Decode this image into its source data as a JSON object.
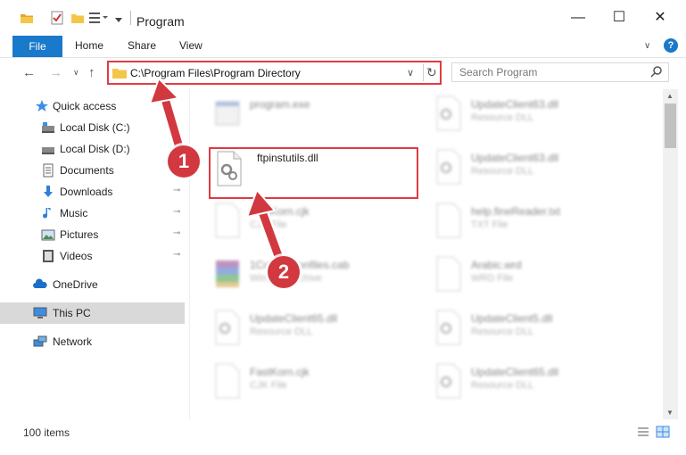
{
  "window": {
    "title": "Program",
    "controls": {
      "minimize": "—",
      "maximize": "☐",
      "close": "✕"
    }
  },
  "ribbon": {
    "tabs": [
      "File",
      "Home",
      "Share",
      "View"
    ],
    "expand_glyph": "∨",
    "help_glyph": "?"
  },
  "nav": {
    "back_glyph": "←",
    "forward_glyph": "→",
    "recent_glyph": "∨",
    "up_glyph": "↑",
    "address": "C:\\Program Files\\Program Directory",
    "address_dropdown_glyph": "∨",
    "refresh_glyph": "↻",
    "search_placeholder": "Search Program"
  },
  "sidebar": {
    "items": [
      {
        "label": "Quick access",
        "icon": "star-icon",
        "pinned": false
      },
      {
        "label": "Local Disk (C:)",
        "icon": "drive-icon",
        "pinned": false
      },
      {
        "label": "Local Disk (D:)",
        "icon": "drive-icon",
        "pinned": false
      },
      {
        "label": "Documents",
        "icon": "documents-icon",
        "pinned": false
      },
      {
        "label": "Downloads",
        "icon": "download-icon",
        "pinned": true
      },
      {
        "label": "Music",
        "icon": "music-icon",
        "pinned": true
      },
      {
        "label": "Pictures",
        "icon": "pictures-icon",
        "pinned": true
      },
      {
        "label": "Videos",
        "icon": "videos-icon",
        "pinned": true
      },
      {
        "label": "OneDrive",
        "icon": "cloud-icon",
        "pinned": false
      },
      {
        "label": "This PC",
        "icon": "computer-icon",
        "pinned": false,
        "selected": true
      },
      {
        "label": "Network",
        "icon": "network-icon",
        "pinned": false
      }
    ],
    "pin_glyph": "📌"
  },
  "files": {
    "left": [
      {
        "name": "program.exe",
        "type": "",
        "icon": "exe-icon"
      },
      {
        "name": "ftpinstutils.dll",
        "type": "",
        "icon": "dll-gear-icon",
        "highlighted": true
      },
      {
        "name": "FastKorn.cjk",
        "type": "CJK File",
        "icon": "file-icon"
      },
      {
        "name": "1Connectionfiles.cab",
        "type": "WinRAR archive",
        "icon": "winrar-icon"
      },
      {
        "name": "UpdateClient65.dll",
        "type": "Resource DLL",
        "icon": "dll-gear-icon"
      },
      {
        "name": "FastKorn.cjk",
        "type": "CJK File",
        "icon": "file-icon"
      }
    ],
    "right": [
      {
        "name": "UpdateClient63.dll",
        "type": "Resource DLL",
        "icon": "dll-gear-icon"
      },
      {
        "name": "UpdateClient63.dll",
        "type": "Resource DLL",
        "icon": "dll-gear-icon"
      },
      {
        "name": "help.fineReader.txt",
        "type": "TXT File",
        "icon": "file-icon"
      },
      {
        "name": "Arabic.wrd",
        "type": "WRD File",
        "icon": "file-icon"
      },
      {
        "name": "UpdateClient5.dll",
        "type": "Resource DLL",
        "icon": "dll-gear-icon"
      },
      {
        "name": "UpdateClient65.dll",
        "type": "Resource DLL",
        "icon": "dll-gear-icon"
      }
    ]
  },
  "status": {
    "count": "100 items"
  },
  "annotations": {
    "step1": "1",
    "step2": "2"
  },
  "colors": {
    "accent": "#1979ca",
    "highlight": "#e03b41",
    "badge": "#d2383f"
  }
}
